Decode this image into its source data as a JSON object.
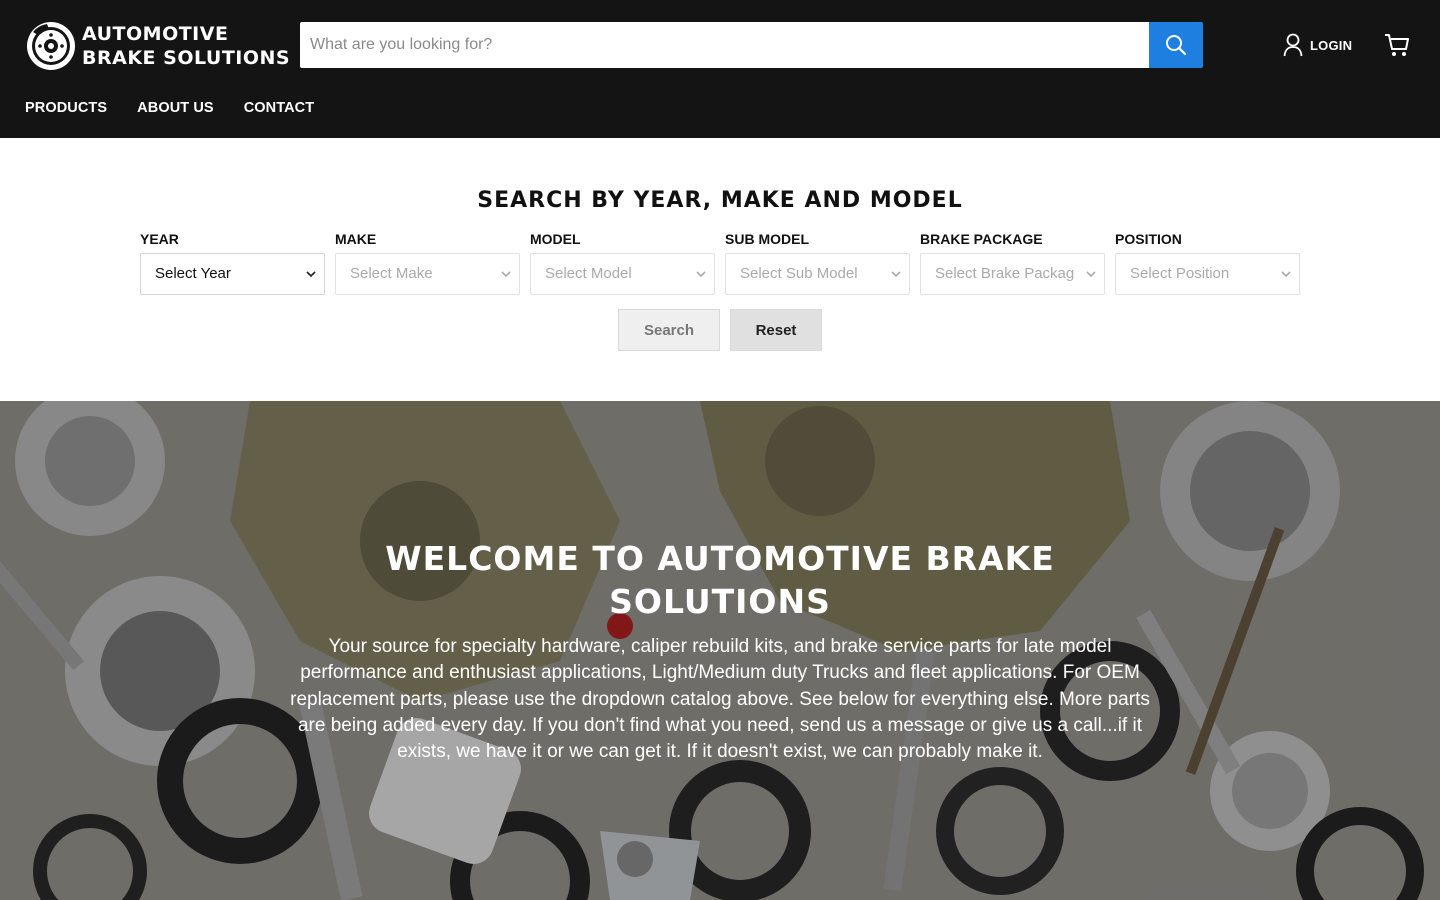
{
  "header": {
    "logo": {
      "line1": "AUTOMOTIVE",
      "line2": "BRAKE SOLUTIONS",
      "icon": "brake-disc-icon"
    },
    "search": {
      "placeholder": "What are you looking for?",
      "value": "",
      "icon": "search-icon"
    },
    "login_label": "LOGIN",
    "cart_icon": "cart-icon",
    "nav": [
      "PRODUCTS",
      "ABOUT US",
      "CONTACT"
    ]
  },
  "ymm": {
    "title": "SEARCH BY YEAR, MAKE AND MODEL",
    "fields": [
      {
        "label": "YEAR",
        "value": "Select Year",
        "enabled": true
      },
      {
        "label": "MAKE",
        "value": "Select Make",
        "enabled": false
      },
      {
        "label": "MODEL",
        "value": "Select Model",
        "enabled": false
      },
      {
        "label": "SUB MODEL",
        "value": "Select Sub Model",
        "enabled": false
      },
      {
        "label": "BRAKE PACKAGE",
        "value": "Select Brake Package",
        "enabled": false
      },
      {
        "label": "POSITION",
        "value": "Select Position",
        "enabled": false
      }
    ],
    "search_label": "Search",
    "reset_label": "Reset"
  },
  "hero": {
    "title_line1": "WELCOME TO AUTOMOTIVE BRAKE",
    "title_line2": "SOLUTIONS",
    "body": "Your source for specialty hardware, caliper rebuild kits, and brake service parts for late model performance and enthusiast applications, Light/Medium duty Trucks and fleet applications. For OEM replacement parts, please use the dropdown catalog above. See below for everything else. More parts are being added every day. If you don't find what you need, send us a message or give us a call...if it exists, we have it or we can get it. If it doesn't exist, we can probably make it."
  },
  "colors": {
    "header_bg": "#141414",
    "accent": "#1e7fe0",
    "white": "#ffffff"
  }
}
